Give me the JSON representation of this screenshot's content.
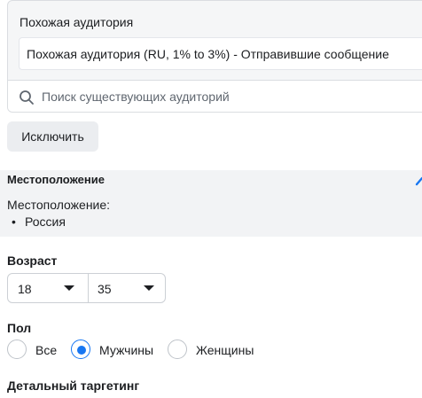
{
  "custom_audience": {
    "heading": "Похожая аудитория",
    "selected": "Похожая аудитория (RU, 1% to 3%) - Отправившие сообщение",
    "search_placeholder": "Поиск существующих аудиторий",
    "search_value": ""
  },
  "exclude_button": "Исключить",
  "location": {
    "title": "Местоположение",
    "label": "Местоположение:",
    "items": [
      "Россия"
    ]
  },
  "age": {
    "label": "Возраст",
    "from": "18",
    "to": "35"
  },
  "gender": {
    "label": "Пол",
    "options": [
      "Все",
      "Мужчины",
      "Женщины"
    ],
    "selected": "Мужчины"
  },
  "detailed_targeting": {
    "label": "Детальный таргетинг"
  },
  "colors": {
    "accent": "#1877f2",
    "panel_bg": "#f2f3f5",
    "border": "#ccd0d5"
  }
}
